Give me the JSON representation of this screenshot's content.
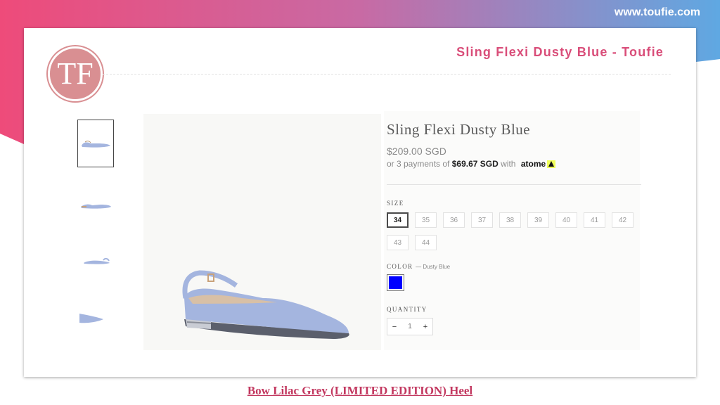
{
  "site_url": "www.toufie.com",
  "slide": {
    "title": "Sling Flexi Dusty Blue - Toufie",
    "logo_letter": "TF"
  },
  "product": {
    "title": "Sling Flexi Dusty Blue",
    "price": "$209.00 SGD",
    "installment_prefix": "or 3 payments of",
    "installment_amount": "$69.67 SGD",
    "installment_suffix": "with",
    "payment_brand": "atome",
    "size_label": "SIZE",
    "sizes_row1": [
      "34",
      "35",
      "36",
      "37",
      "38",
      "39",
      "40",
      "41",
      "42"
    ],
    "sizes_row2": [
      "43",
      "44"
    ],
    "selected_size": "34",
    "color_label": "COLOR",
    "color_value": "— Dusty Blue",
    "color_swatch": "#0000ff",
    "quantity_label": "QUANTITY",
    "quantity_minus": "−",
    "quantity_value": "1",
    "quantity_plus": "+"
  },
  "thumbnails": [
    "shoe-side-thumbnail",
    "shoe-angle-thumbnail",
    "shoe-back-thumbnail",
    "shoe-toe-thumbnail"
  ],
  "footer_link": "Bow Lilac Grey (LIMITED EDITION) Heel",
  "colors": {
    "accent_pink": "#d94d79",
    "link": "#c2375f",
    "shoe": "#a4b5df",
    "logo": "#d98f92"
  }
}
